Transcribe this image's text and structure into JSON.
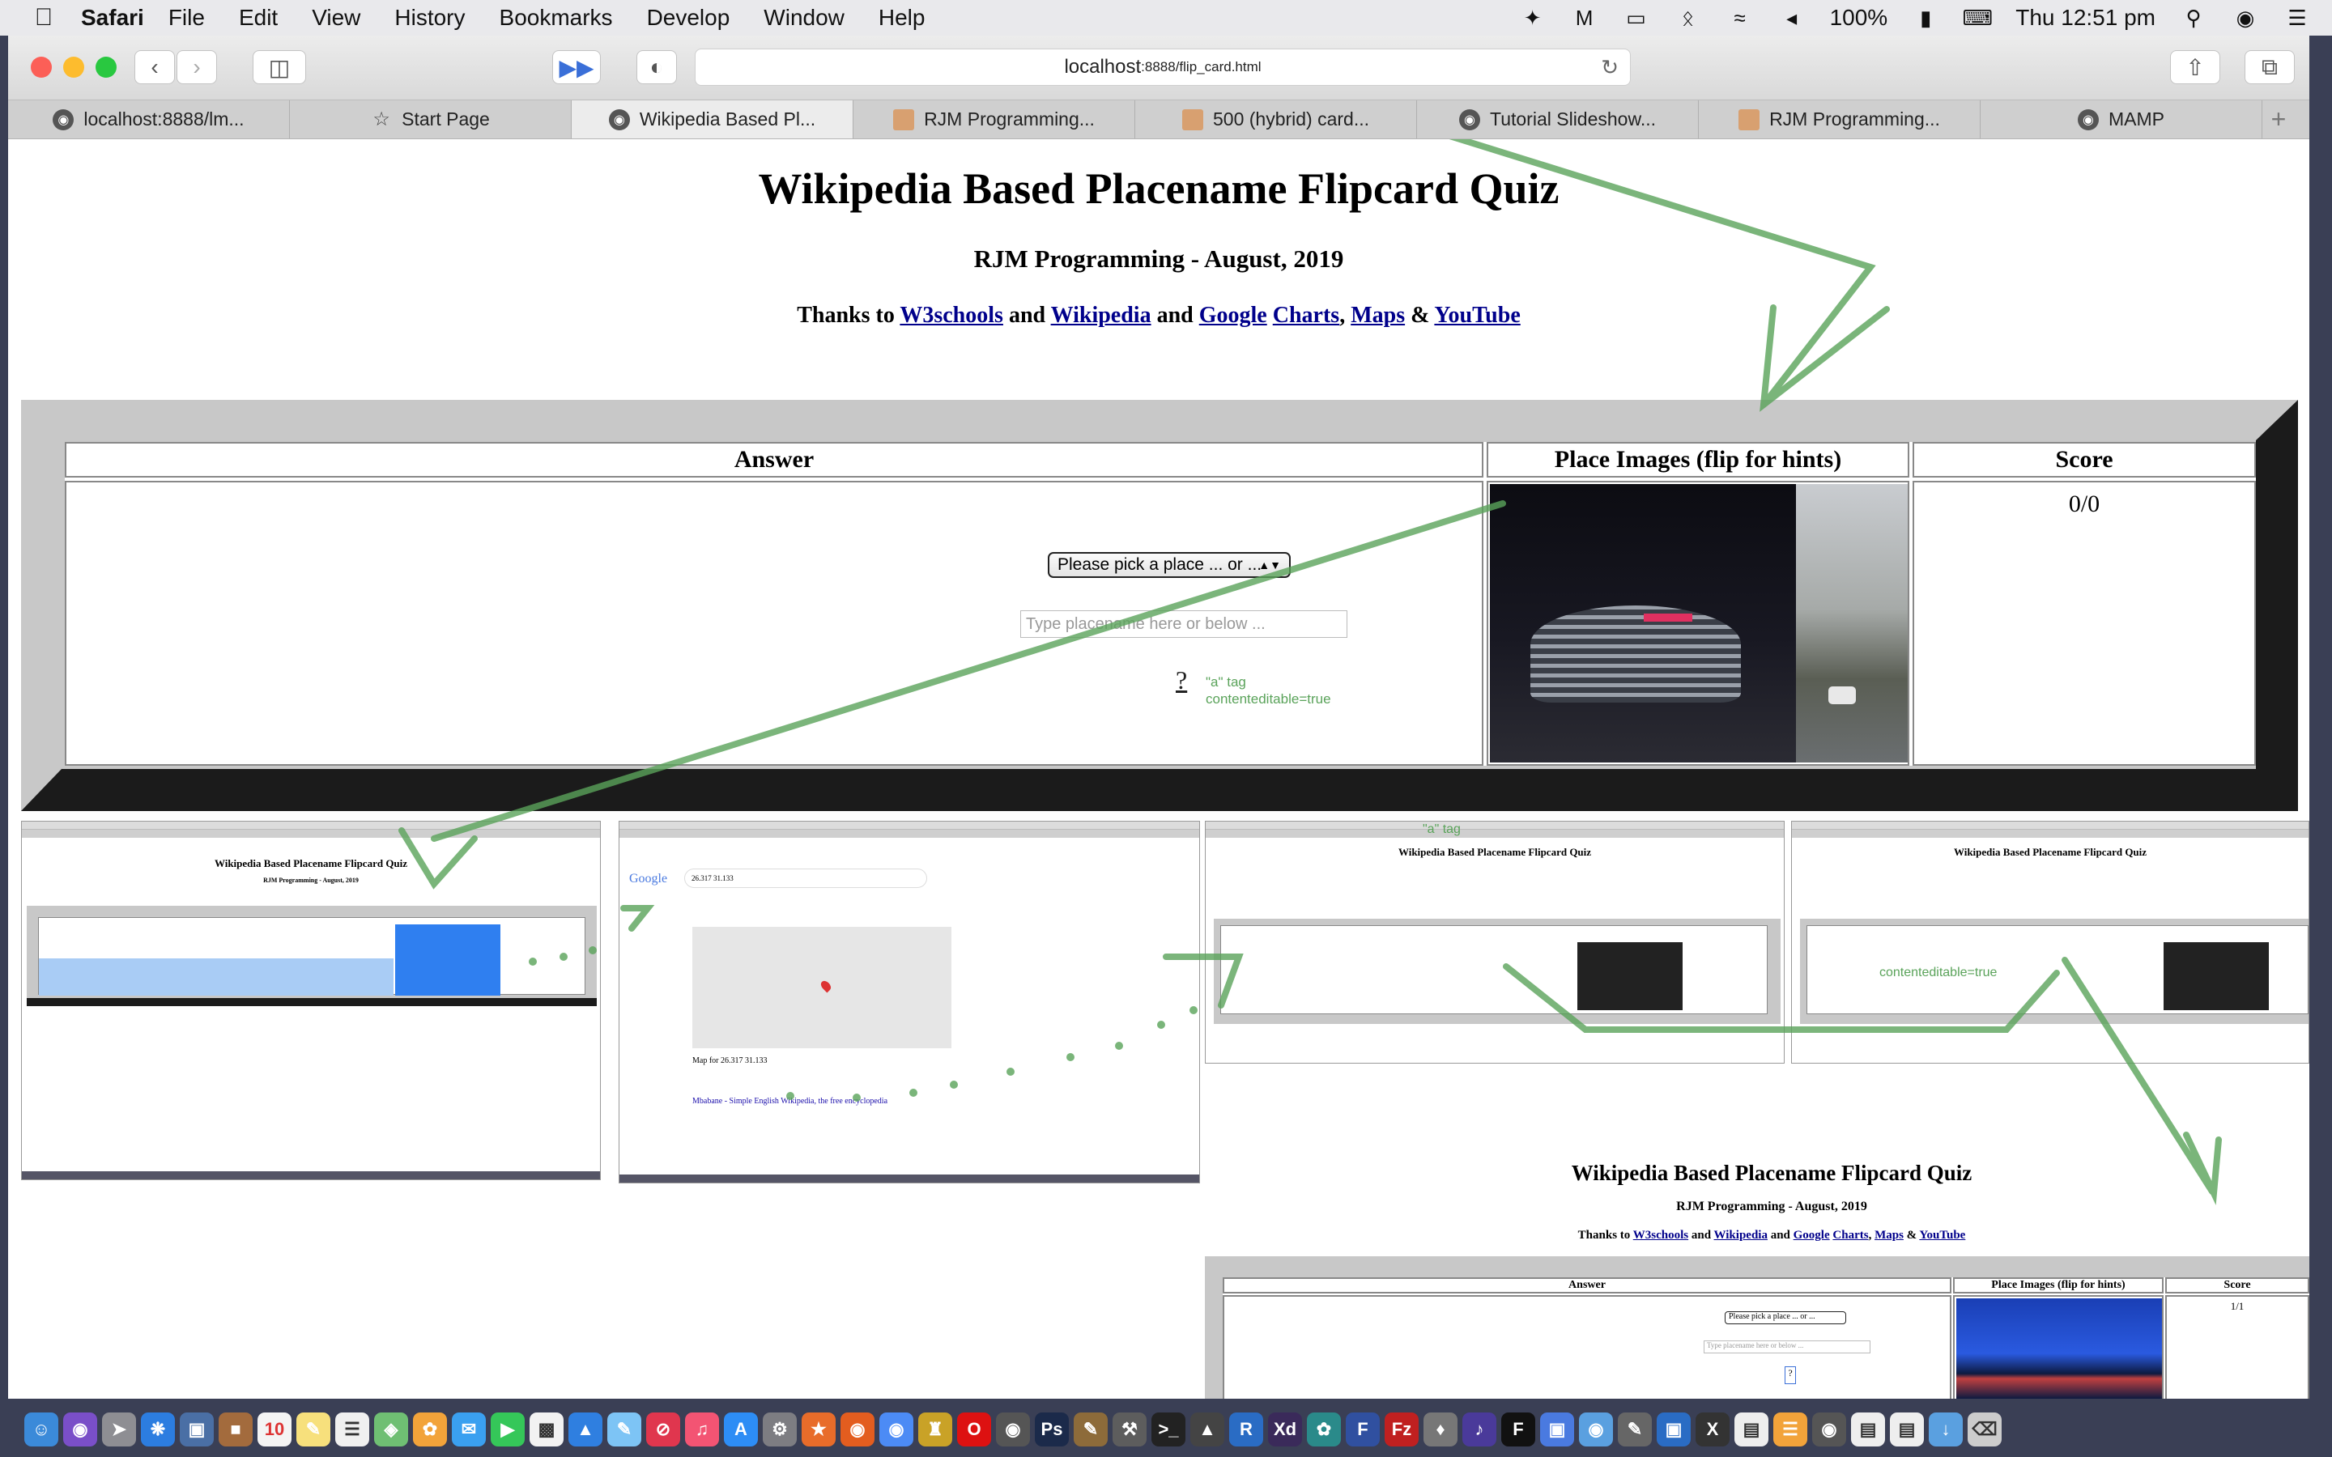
{
  "menubar": {
    "app_name": "Safari",
    "items": [
      "File",
      "Edit",
      "View",
      "History",
      "Bookmarks",
      "Develop",
      "Window",
      "Help"
    ],
    "battery": "100%",
    "clock": "Thu 12:51 pm"
  },
  "browser": {
    "url_host": "localhost",
    "url_path": ":8888/flip_card.html",
    "tabs": [
      {
        "label": "localhost:8888/lm...",
        "icon": "elephant-icon"
      },
      {
        "label": "Start Page",
        "icon": "star-icon"
      },
      {
        "label": "Wikipedia Based Pl...",
        "icon": "elephant-icon",
        "active": true
      },
      {
        "label": "RJM Programming...",
        "icon": "rjm-icon"
      },
      {
        "label": "500 (hybrid) card...",
        "icon": "rjm-icon"
      },
      {
        "label": "Tutorial Slideshow...",
        "icon": "elephant-icon"
      },
      {
        "label": "RJM Programming...",
        "icon": "rjm-icon"
      },
      {
        "label": "MAMP",
        "icon": "elephant-icon"
      }
    ]
  },
  "page": {
    "title": "Wikipedia Based Placename Flipcard Quiz",
    "subtitle": "RJM Programming - August, 2019",
    "thanks_prefix": "Thanks to",
    "links": {
      "w3schools": "W3schools",
      "and1": "and",
      "wikipedia": "Wikipedia",
      "and2": "and",
      "google": "Google",
      "charts": "Charts",
      "comma1": ",",
      "maps": "Maps",
      "amp": "&",
      "youtube": "YouTube"
    },
    "table": {
      "answer_header": "Answer",
      "images_header": "Place Images (flip for hints)",
      "score_header": "Score",
      "select_value": "Please pick a place ... or ...",
      "input_placeholder": "Type placename here or below ...",
      "hint_link": "?",
      "annotation": [
        "\"a\" tag",
        "contenteditable=true"
      ],
      "score": "0/0"
    }
  },
  "montage": {
    "google_query": "26.317 31.133",
    "google_logo": "Google",
    "map_caption": "Map for 26.317 31.133",
    "result_title": "Mbabane - Simple English Wikipedia, the free encyclopedia",
    "annot_a_tag": "\"a\" tag",
    "annot_contenteditable": "contenteditable=true",
    "big_title": "Wikipedia Based Placename Flipcard Quiz",
    "big_subtitle": "RJM Programming - August, 2019",
    "big_thanks_prefix": "Thanks to",
    "big_links": [
      "W3schools",
      "Wikipedia",
      "Google",
      "Charts",
      "Maps",
      "YouTube"
    ],
    "big_answer": "Answer",
    "big_images": "Place Images (flip for hints)",
    "big_score_header": "Score",
    "big_score": "1/1",
    "big_select": "Please pick a place ... or ...",
    "big_input": "Type placename here or below ...",
    "mini_title": "Wikipedia Based Placename Flipcard Quiz",
    "mini_subtitle": "RJM Programming - August, 2019"
  },
  "colors": {
    "annotation_green": "#5aa35a",
    "link_navy": "#00008b",
    "frame_grey": "#c8c8c8",
    "frame_shadow": "#1b1b1b"
  }
}
